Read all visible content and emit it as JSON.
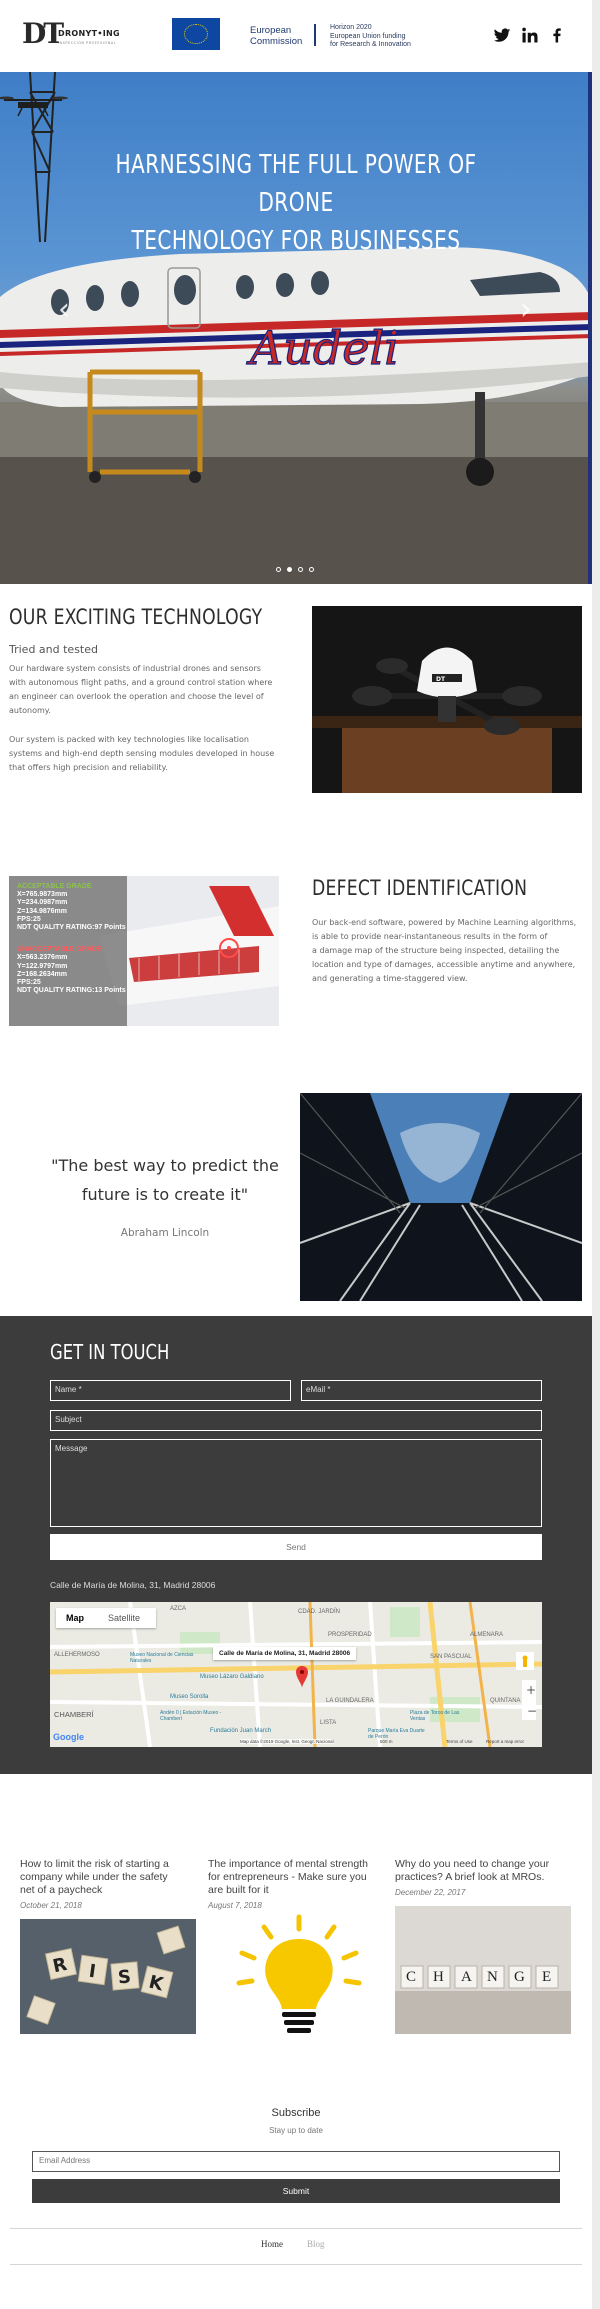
{
  "header": {
    "logo_letters": "DT",
    "logo_name": "DRONYT•ING",
    "logo_tagline": "INSPECCIÓN PROFESIONAL",
    "eu_line1": "European",
    "eu_line2": "Commission",
    "horizon_line1": "Horizon 2020",
    "horizon_line2": "European Union funding",
    "horizon_line3": "for Research & Innovation",
    "social_icons": [
      "twitter-icon",
      "linkedin-icon",
      "facebook-icon"
    ]
  },
  "hero": {
    "title_line1": "HARNESSING THE FULL POWER OF DRONE",
    "title_line2": "TECHNOLOGY FOR BUSINESSES",
    "slide_count": 4,
    "active_slide": 2,
    "prev_arrow": "‹",
    "next_arrow": "›"
  },
  "tech": {
    "title": "OUR EXCITING TECHNOLOGY",
    "subtitle": "Tried and tested",
    "para1_l1": "Our hardware system consists of industrial drones and sensors",
    "para1_l2": "with autonomous flight paths, and a ground control station where",
    "para1_l3": "an engineer can overlook the operation and choose the level of",
    "para1_l4": "autonomy.",
    "para2_l1": "Our system is packed with key technologies like localisation",
    "para2_l2": "systems and high-end depth sensing modules developed in house",
    "para2_l3": "that offers high precision and reliability."
  },
  "defect": {
    "title": "DEFECT IDENTIFICATION",
    "l1": "Our back-end software, powered by Machine Learning algorithms,",
    "l2": "is able to provide near-instantaneous results in the form of",
    "l3": "a damage map of the structure being inspected, detailing the",
    "l4": "location and type of damages, accessible anytime and anywhere,",
    "l5": "and generating a time-staggered view.",
    "overlay": {
      "good_title": "ACCEPTABLE GRADE",
      "good_x": "X=765.9873mm",
      "good_y": "Y=234.0987mm",
      "good_z": "Z=134.9876mm",
      "good_fps": "FPS:25",
      "good_rating": "NDT QUALITY RATING:97 Points",
      "bad_title": "UNACCEPTABLE GRADE",
      "bad_x": "X=563.2376mm",
      "bad_y": "Y=122.9797mm",
      "bad_z": "Z=168.2634mm",
      "bad_fps": "FPS:25",
      "bad_rating": "NDT QUALITY RATING:13 Points"
    }
  },
  "quote": {
    "line1": "\"The best way to predict the",
    "line2": "future is to create it\"",
    "author": "Abraham Lincoln"
  },
  "contact": {
    "title": "GET IN TOUCH",
    "name_placeholder": "Name *",
    "email_placeholder": "eMail *",
    "subject_placeholder": "Subject",
    "message_placeholder": "Message",
    "send_label": "Send",
    "address": "Calle de María de Molina, 31, Madrid 28006",
    "map": {
      "tab_map": "Map",
      "tab_satellite": "Satellite",
      "popup": "Calle de María de Molina, 31, Madrid 28006",
      "labels": [
        "AZCA",
        "CDAD. JARDÍN",
        "PROSPERIDAD",
        "ALMENARA",
        "SAN PASCUAL",
        "ALLEHERMOSO",
        "Museo Nacional de Ciencias Naturales",
        "Museo Lázaro Galdiano",
        "Museo Sorolla",
        "LA GUINDALERA",
        "CHAMBERÍ",
        "Andén 0 | Estación Museo - Chamberí",
        "Fundación Juan March",
        "LISTA",
        "Plaza de Toros de Las Ventas",
        "Parque María Eva Duarte de Perón",
        "QUINTANA"
      ],
      "attribution": "Map data ©2019 Google, Inst. Geogr. Nacional",
      "scale": "500 m",
      "terms": "Terms of Use",
      "report": "Report a map error",
      "google": "Google"
    }
  },
  "blog": [
    {
      "l1": "How to limit the risk of starting a",
      "l2": "company while under the safety",
      "l3": "net of a paycheck",
      "date": "October 21, 2018",
      "tiles": [
        "R",
        "I",
        "S",
        "K"
      ]
    },
    {
      "l1": "The importance of mental strength",
      "l2": "for entrepreneurs - Make sure you",
      "l3": "are built for it",
      "date": "August 7, 2018"
    },
    {
      "l1": "Why do you need to change your",
      "l2": "practices? A brief look at MROs.",
      "l3": "",
      "date": "December 22, 2017",
      "tiles": [
        "C",
        "H",
        "A",
        "N",
        "G",
        "E"
      ]
    }
  ],
  "subscribe": {
    "title": "Subscribe",
    "subtitle": "Stay up to date",
    "email_placeholder": "Email Address",
    "submit_label": "Submit"
  },
  "footer": {
    "home": "Home",
    "blog": "Blog"
  },
  "colors": {
    "dark_section": "#3c3c3c",
    "hero_sky": "#4a86cc",
    "accent_red": "#e53935"
  }
}
